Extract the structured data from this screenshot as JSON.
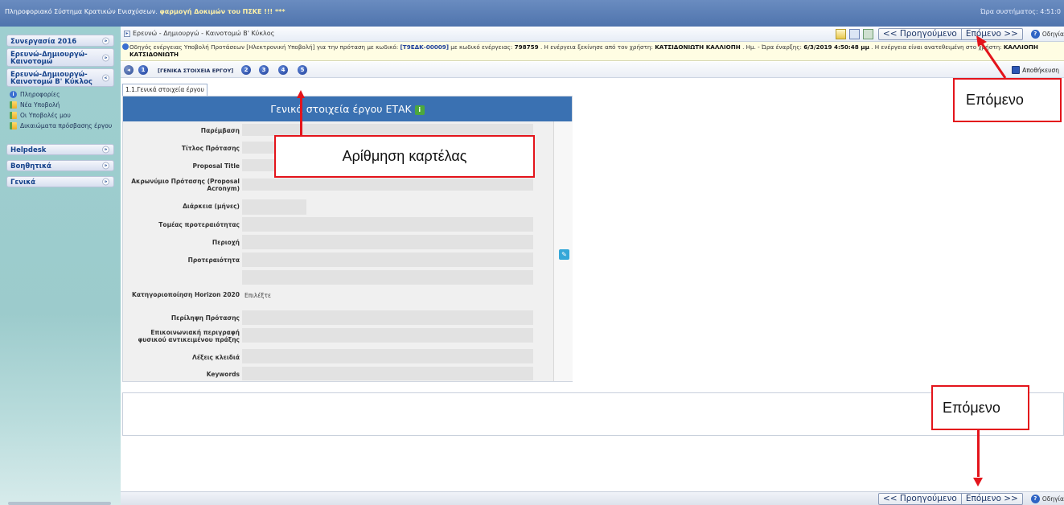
{
  "app": {
    "system_title_prefix": "Πληροφοριακό Σύστημα Κρατικών Ενισχύσεων.",
    "system_title_highlight": "φαρμογή Δοκιμών του ΠΣΚΕ !!! ***",
    "time_label": "Ώρα συστήματος: 4:51:0"
  },
  "sidebar": {
    "sections": [
      {
        "label": "Συνεργασία 2016"
      },
      {
        "label": "Ερευνώ-Δημιουργώ-Καινοτομώ"
      },
      {
        "label": "Ερευνώ-Δημιουργώ-Καινοτομώ Β' Κύκλος"
      },
      {
        "label": "Helpdesk"
      },
      {
        "label": "Βοηθητικά"
      },
      {
        "label": "Γενικά"
      }
    ],
    "sub_items": [
      {
        "label": "Πληροφορίες",
        "icon": "info-icon"
      },
      {
        "label": "Νέα Υποβολή",
        "icon": "folder-icon"
      },
      {
        "label": "Οι Υποβολές μου",
        "icon": "folder-icon"
      },
      {
        "label": "Δικαιώματα πρόσβασης έργου",
        "icon": "folder-icon"
      }
    ]
  },
  "header": {
    "breadcrumb": "Ερευνώ - Δημιουργώ - Καινοτομώ Β' Κύκλος",
    "prev_label": "<< Προηγούμενο",
    "next_label": "Επόμενο >>",
    "help_label": "Οδηγία"
  },
  "info_bar": {
    "t1": "Οδηγός ενέργειας Υποβολή Προτάσεων [Ηλεκτρονική Υποβολή] για την πρόταση με κωδικό: ",
    "code": "[Τ9ΕΔΚ-00009]",
    "t2": " με κωδικό ενέργειας: ",
    "action_code": "798759",
    "t3": " . Η ενέργεια ξεκίνησε από τον χρήστη: ",
    "user": "ΚΑΤΣΙΔΟΝΙΩΤΗ ΚΑΛΛΙΟΠΗ",
    "t4": " . Ημ. - Ώρα έναρξης: ",
    "start": "6/3/2019 4:50:48 μμ",
    "t5": " . Η ενέργεια είναι ανατεθειμένη στο χρήστη: ",
    "assigned": "ΚΑΛΛΙΟΠΗ",
    "line2": "ΚΑΤΣΙΔΟΝΙΩΤΗ"
  },
  "steps": {
    "items": [
      "1",
      "2",
      "3",
      "4",
      "5"
    ],
    "current_label": "[ΓΕΝΙΚΑ ΣΤΟΙΧΕΙΑ ΕΡΓΟΥ]",
    "save_label": "Αποθήκευση"
  },
  "tab": {
    "label": "1.1.Γενικά στοιχεία έργου"
  },
  "panel": {
    "title": "Γενικά στοιχεία έργου ΕΤΑΚ",
    "fields": [
      {
        "label": "Παρέμβαση",
        "value": ""
      },
      {
        "label": "Τίτλος Πρότασης",
        "value": ""
      },
      {
        "label": "Proposal Title",
        "value": ""
      },
      {
        "label": "Ακρωνύμιο Πρότασης (Proposal Acronym)",
        "value": ""
      },
      {
        "label": "Διάρκεια (μήνες)",
        "value": ""
      },
      {
        "label": "Τομέας προτεραιότητας",
        "value": ""
      },
      {
        "label": "Περιοχή",
        "value": ""
      },
      {
        "label": "Προτεραιότητα",
        "value": ""
      },
      {
        "label": "Κατηγοριοποίηση Horizon 2020",
        "value": "Επιλέξτε"
      },
      {
        "label": "Περίληψη Πρότασης",
        "value": ""
      },
      {
        "label": "Επικοινωνιακή περιγραφή φυσικού αντικειμένου πράξης",
        "value": ""
      },
      {
        "label": "Λέξεις κλειδιά",
        "value": ""
      },
      {
        "label": "Keywords",
        "value": ""
      }
    ]
  },
  "annotations": {
    "tab_numbering": "Αρίθμηση καρτέλας",
    "next_top": "Επόμενο",
    "next_bottom": "Επόμενο",
    "color": "#e3141b"
  }
}
